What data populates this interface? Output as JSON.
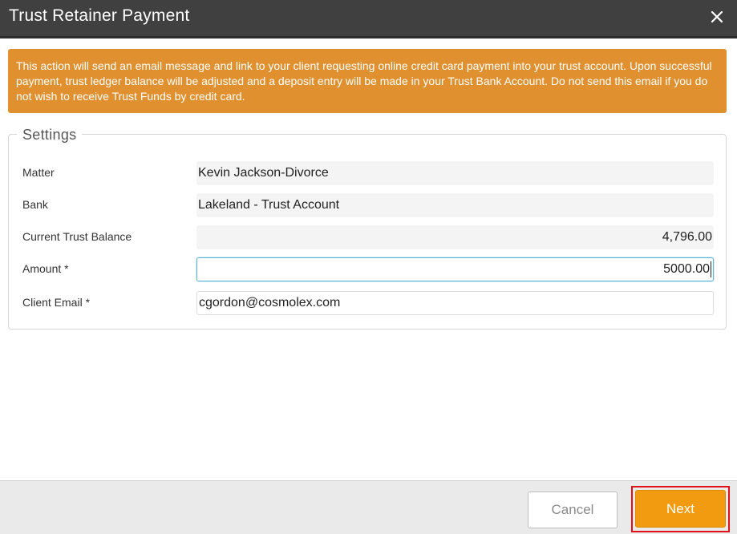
{
  "dialog": {
    "title": "Trust Retainer Payment",
    "close_icon": "close-icon"
  },
  "notice": {
    "text": "This action will send an email message and link to your client requesting online credit card payment into your trust account. Upon successful payment, trust ledger balance will be adjusted and a deposit entry will be made in your Trust Bank Account. Do not send this email if you do not wish to receive Trust Funds by credit card.",
    "color": "#e0902e"
  },
  "settings": {
    "legend": "Settings",
    "matter": {
      "label": "Matter",
      "value": "Kevin Jackson-Divorce"
    },
    "bank": {
      "label": "Bank",
      "value": "Lakeland - Trust Account"
    },
    "balance": {
      "label": "Current Trust Balance",
      "value": "4,796.00"
    },
    "amount": {
      "label": "Amount *",
      "value": "5000.00"
    },
    "email": {
      "label": "Client Email *",
      "value": "cgordon@cosmolex.com"
    }
  },
  "footer": {
    "cancel_label": "Cancel",
    "next_label": "Next",
    "next_color": "#f29b11",
    "highlight_color": "#e0101a"
  }
}
